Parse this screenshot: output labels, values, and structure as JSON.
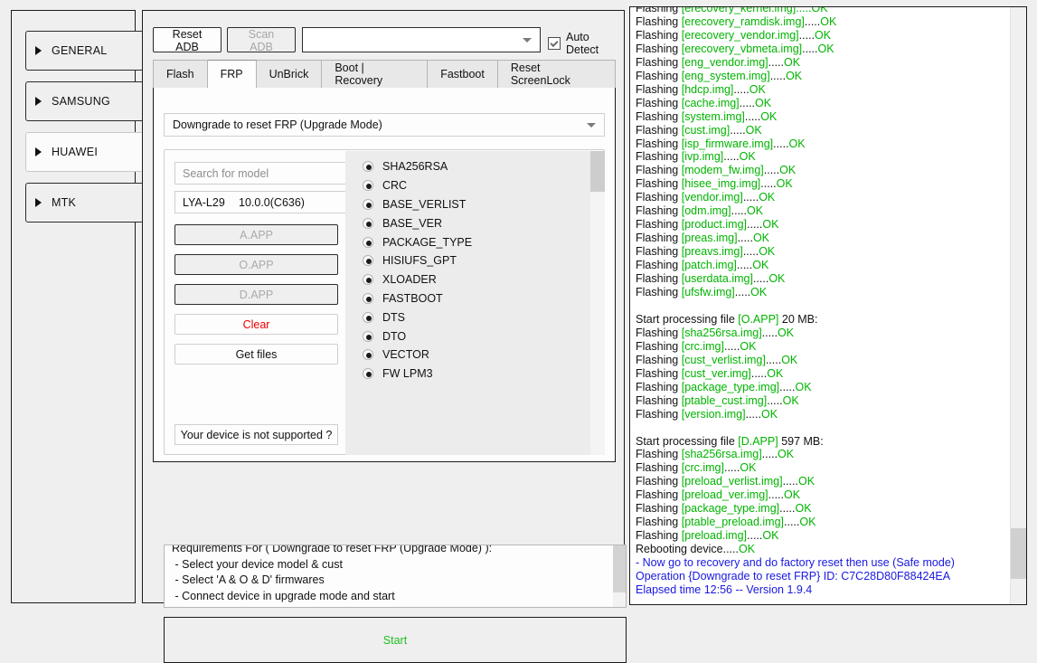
{
  "sidebar": {
    "items": [
      {
        "label": "GENERAL",
        "active": false
      },
      {
        "label": "SAMSUNG",
        "active": false
      },
      {
        "label": "HUAWEI",
        "active": true
      },
      {
        "label": "MTK",
        "active": false
      }
    ]
  },
  "toolbar": {
    "reset_adb_label": "Reset ADB",
    "scan_adb_label": "Scan ADB",
    "device_combo_value": "",
    "auto_detect_label": "Auto Detect",
    "auto_detect_checked": true
  },
  "tabs": [
    {
      "label": "Flash",
      "active": false
    },
    {
      "label": "FRP",
      "active": true
    },
    {
      "label": "UnBrick",
      "active": false
    },
    {
      "label": "Boot | Recovery",
      "active": false
    },
    {
      "label": "Fastboot",
      "active": false
    },
    {
      "label": "Reset ScreenLock",
      "active": false
    }
  ],
  "frp": {
    "mode_combo_value": "Downgrade to reset FRP (Upgrade Mode)",
    "search_placeholder": "Search for model",
    "search_value": "",
    "model_name": "LYA-L29",
    "model_version": "10.0.0(C636)",
    "buttons": {
      "a_app": "A.APP",
      "o_app": "O.APP",
      "d_app": "D.APP",
      "clear": "Clear",
      "get_files": "Get files",
      "unsupported": "Your device is not supported ?"
    },
    "partitions": [
      "SHA256RSA",
      "CRC",
      "BASE_VERLIST",
      "BASE_VER",
      "PACKAGE_TYPE",
      "HISIUFS_GPT",
      "XLOADER",
      "FASTBOOT",
      "DTS",
      "DTO",
      "VECTOR",
      "FW LPM3"
    ],
    "requirements": "Requirements For ( Downgrade to reset FRP (Upgrade Mode) ):\n - Select your device model & cust\n - Select 'A & O & D' firmwares\n - Connect device in upgrade mode and start",
    "start_label": "Start"
  },
  "colors": {
    "ok_green": "#00b400",
    "info_blue": "#1818e0",
    "clear_red": "#ee0000",
    "start_green": "#1fbf1f"
  },
  "log": {
    "lines": [
      {
        "segments": [
          {
            "t": "Flashing ",
            "c": "k"
          },
          {
            "t": "[erecovery_kernel.img].....OK",
            "c": "g"
          }
        ]
      },
      {
        "segments": [
          {
            "t": "Flashing ",
            "c": "k"
          },
          {
            "t": "[erecovery_ramdisk.img]",
            "c": "g"
          },
          {
            "t": ".....",
            "c": "k"
          },
          {
            "t": "OK",
            "c": "g"
          }
        ]
      },
      {
        "segments": [
          {
            "t": "Flashing ",
            "c": "k"
          },
          {
            "t": "[erecovery_vendor.img]",
            "c": "g"
          },
          {
            "t": ".....",
            "c": "k"
          },
          {
            "t": "OK",
            "c": "g"
          }
        ]
      },
      {
        "segments": [
          {
            "t": "Flashing ",
            "c": "k"
          },
          {
            "t": "[erecovery_vbmeta.img]",
            "c": "g"
          },
          {
            "t": ".....",
            "c": "k"
          },
          {
            "t": "OK",
            "c": "g"
          }
        ]
      },
      {
        "segments": [
          {
            "t": "Flashing ",
            "c": "k"
          },
          {
            "t": "[eng_vendor.img]",
            "c": "g"
          },
          {
            "t": ".....",
            "c": "k"
          },
          {
            "t": "OK",
            "c": "g"
          }
        ]
      },
      {
        "segments": [
          {
            "t": "Flashing ",
            "c": "k"
          },
          {
            "t": "[eng_system.img]",
            "c": "g"
          },
          {
            "t": ".....",
            "c": "k"
          },
          {
            "t": "OK",
            "c": "g"
          }
        ]
      },
      {
        "segments": [
          {
            "t": "Flashing ",
            "c": "k"
          },
          {
            "t": "[hdcp.img]",
            "c": "g"
          },
          {
            "t": ".....",
            "c": "k"
          },
          {
            "t": "OK",
            "c": "g"
          }
        ]
      },
      {
        "segments": [
          {
            "t": "Flashing ",
            "c": "k"
          },
          {
            "t": "[cache.img]",
            "c": "g"
          },
          {
            "t": ".....",
            "c": "k"
          },
          {
            "t": "OK",
            "c": "g"
          }
        ]
      },
      {
        "segments": [
          {
            "t": "Flashing ",
            "c": "k"
          },
          {
            "t": "[system.img]",
            "c": "g"
          },
          {
            "t": ".....",
            "c": "k"
          },
          {
            "t": "OK",
            "c": "g"
          }
        ]
      },
      {
        "segments": [
          {
            "t": "Flashing ",
            "c": "k"
          },
          {
            "t": "[cust.img]",
            "c": "g"
          },
          {
            "t": ".....",
            "c": "k"
          },
          {
            "t": "OK",
            "c": "g"
          }
        ]
      },
      {
        "segments": [
          {
            "t": "Flashing ",
            "c": "k"
          },
          {
            "t": "[isp_firmware.img]",
            "c": "g"
          },
          {
            "t": ".....",
            "c": "k"
          },
          {
            "t": "OK",
            "c": "g"
          }
        ]
      },
      {
        "segments": [
          {
            "t": "Flashing ",
            "c": "k"
          },
          {
            "t": "[ivp.img]",
            "c": "g"
          },
          {
            "t": ".....",
            "c": "k"
          },
          {
            "t": "OK",
            "c": "g"
          }
        ]
      },
      {
        "segments": [
          {
            "t": "Flashing ",
            "c": "k"
          },
          {
            "t": "[modem_fw.img]",
            "c": "g"
          },
          {
            "t": ".....",
            "c": "k"
          },
          {
            "t": "OK",
            "c": "g"
          }
        ]
      },
      {
        "segments": [
          {
            "t": "Flashing ",
            "c": "k"
          },
          {
            "t": "[hisee_img.img]",
            "c": "g"
          },
          {
            "t": ".....",
            "c": "k"
          },
          {
            "t": "OK",
            "c": "g"
          }
        ]
      },
      {
        "segments": [
          {
            "t": "Flashing ",
            "c": "k"
          },
          {
            "t": "[vendor.img]",
            "c": "g"
          },
          {
            "t": ".....",
            "c": "k"
          },
          {
            "t": "OK",
            "c": "g"
          }
        ]
      },
      {
        "segments": [
          {
            "t": "Flashing ",
            "c": "k"
          },
          {
            "t": "[odm.img]",
            "c": "g"
          },
          {
            "t": ".....",
            "c": "k"
          },
          {
            "t": "OK",
            "c": "g"
          }
        ]
      },
      {
        "segments": [
          {
            "t": "Flashing ",
            "c": "k"
          },
          {
            "t": "[product.img]",
            "c": "g"
          },
          {
            "t": ".....",
            "c": "k"
          },
          {
            "t": "OK",
            "c": "g"
          }
        ]
      },
      {
        "segments": [
          {
            "t": "Flashing ",
            "c": "k"
          },
          {
            "t": "[preas.img]",
            "c": "g"
          },
          {
            "t": ".....",
            "c": "k"
          },
          {
            "t": "OK",
            "c": "g"
          }
        ]
      },
      {
        "segments": [
          {
            "t": "Flashing ",
            "c": "k"
          },
          {
            "t": "[preavs.img]",
            "c": "g"
          },
          {
            "t": ".....",
            "c": "k"
          },
          {
            "t": "OK",
            "c": "g"
          }
        ]
      },
      {
        "segments": [
          {
            "t": "Flashing ",
            "c": "k"
          },
          {
            "t": "[patch.img]",
            "c": "g"
          },
          {
            "t": ".....",
            "c": "k"
          },
          {
            "t": "OK",
            "c": "g"
          }
        ]
      },
      {
        "segments": [
          {
            "t": "Flashing ",
            "c": "k"
          },
          {
            "t": "[userdata.img]",
            "c": "g"
          },
          {
            "t": ".....",
            "c": "k"
          },
          {
            "t": "OK",
            "c": "g"
          }
        ]
      },
      {
        "segments": [
          {
            "t": "Flashing ",
            "c": "k"
          },
          {
            "t": "[ufsfw.img]",
            "c": "g"
          },
          {
            "t": ".....",
            "c": "k"
          },
          {
            "t": "OK",
            "c": "g"
          }
        ]
      },
      {
        "segments": []
      },
      {
        "segments": [
          {
            "t": "Start processing file ",
            "c": "k"
          },
          {
            "t": "[O.APP]",
            "c": "g"
          },
          {
            "t": " 20 MB:",
            "c": "k"
          }
        ]
      },
      {
        "segments": [
          {
            "t": "Flashing ",
            "c": "k"
          },
          {
            "t": "[sha256rsa.img]",
            "c": "g"
          },
          {
            "t": ".....",
            "c": "k"
          },
          {
            "t": "OK",
            "c": "g"
          }
        ]
      },
      {
        "segments": [
          {
            "t": "Flashing ",
            "c": "k"
          },
          {
            "t": "[crc.img]",
            "c": "g"
          },
          {
            "t": ".....",
            "c": "k"
          },
          {
            "t": "OK",
            "c": "g"
          }
        ]
      },
      {
        "segments": [
          {
            "t": "Flashing ",
            "c": "k"
          },
          {
            "t": "[cust_verlist.img]",
            "c": "g"
          },
          {
            "t": ".....",
            "c": "k"
          },
          {
            "t": "OK",
            "c": "g"
          }
        ]
      },
      {
        "segments": [
          {
            "t": "Flashing ",
            "c": "k"
          },
          {
            "t": "[cust_ver.img]",
            "c": "g"
          },
          {
            "t": ".....",
            "c": "k"
          },
          {
            "t": "OK",
            "c": "g"
          }
        ]
      },
      {
        "segments": [
          {
            "t": "Flashing ",
            "c": "k"
          },
          {
            "t": "[package_type.img]",
            "c": "g"
          },
          {
            "t": ".....",
            "c": "k"
          },
          {
            "t": "OK",
            "c": "g"
          }
        ]
      },
      {
        "segments": [
          {
            "t": "Flashing ",
            "c": "k"
          },
          {
            "t": "[ptable_cust.img]",
            "c": "g"
          },
          {
            "t": ".....",
            "c": "k"
          },
          {
            "t": "OK",
            "c": "g"
          }
        ]
      },
      {
        "segments": [
          {
            "t": "Flashing ",
            "c": "k"
          },
          {
            "t": "[version.img]",
            "c": "g"
          },
          {
            "t": ".....",
            "c": "k"
          },
          {
            "t": "OK",
            "c": "g"
          }
        ]
      },
      {
        "segments": []
      },
      {
        "segments": [
          {
            "t": "Start processing file ",
            "c": "k"
          },
          {
            "t": "[D.APP]",
            "c": "g"
          },
          {
            "t": " 597 MB:",
            "c": "k"
          }
        ]
      },
      {
        "segments": [
          {
            "t": "Flashing ",
            "c": "k"
          },
          {
            "t": "[sha256rsa.img]",
            "c": "g"
          },
          {
            "t": ".....",
            "c": "k"
          },
          {
            "t": "OK",
            "c": "g"
          }
        ]
      },
      {
        "segments": [
          {
            "t": "Flashing ",
            "c": "k"
          },
          {
            "t": "[crc.img]",
            "c": "g"
          },
          {
            "t": ".....",
            "c": "k"
          },
          {
            "t": "OK",
            "c": "g"
          }
        ]
      },
      {
        "segments": [
          {
            "t": "Flashing ",
            "c": "k"
          },
          {
            "t": "[preload_verlist.img]",
            "c": "g"
          },
          {
            "t": ".....",
            "c": "k"
          },
          {
            "t": "OK",
            "c": "g"
          }
        ]
      },
      {
        "segments": [
          {
            "t": "Flashing ",
            "c": "k"
          },
          {
            "t": "[preload_ver.img]",
            "c": "g"
          },
          {
            "t": ".....",
            "c": "k"
          },
          {
            "t": "OK",
            "c": "g"
          }
        ]
      },
      {
        "segments": [
          {
            "t": "Flashing ",
            "c": "k"
          },
          {
            "t": "[package_type.img]",
            "c": "g"
          },
          {
            "t": ".....",
            "c": "k"
          },
          {
            "t": "OK",
            "c": "g"
          }
        ]
      },
      {
        "segments": [
          {
            "t": "Flashing ",
            "c": "k"
          },
          {
            "t": "[ptable_preload.img]",
            "c": "g"
          },
          {
            "t": ".....",
            "c": "k"
          },
          {
            "t": "OK",
            "c": "g"
          }
        ]
      },
      {
        "segments": [
          {
            "t": "Flashing ",
            "c": "k"
          },
          {
            "t": "[preload.img]",
            "c": "g"
          },
          {
            "t": ".....",
            "c": "k"
          },
          {
            "t": "OK",
            "c": "g"
          }
        ]
      },
      {
        "segments": [
          {
            "t": "Rebooting device.....",
            "c": "k"
          },
          {
            "t": "OK",
            "c": "g"
          }
        ]
      },
      {
        "segments": [
          {
            "t": "- Now go to recovery and do factory reset then use (Safe mode)",
            "c": "b"
          }
        ]
      },
      {
        "segments": [
          {
            "t": "Operation {Downgrade to reset FRP} ID: C7C28D80F88424EA",
            "c": "b"
          }
        ]
      },
      {
        "segments": [
          {
            "t": "Elapsed time 12:56 -- Version 1.9.4",
            "c": "b"
          }
        ]
      }
    ]
  }
}
